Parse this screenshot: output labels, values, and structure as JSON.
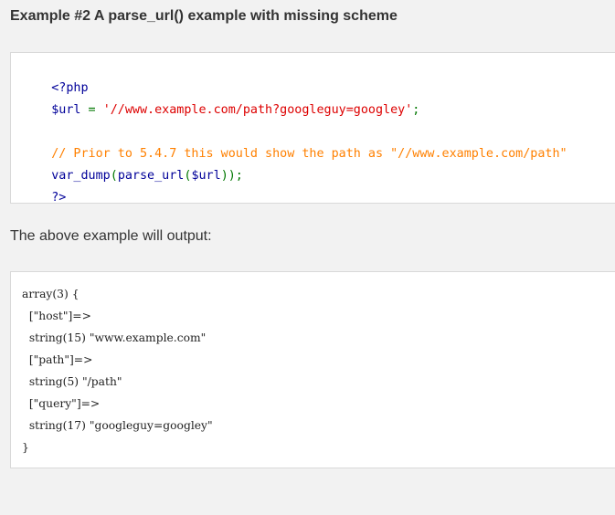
{
  "example": {
    "title": "Example #2 A parse_url() example with missing scheme"
  },
  "code": {
    "line1": "<?php",
    "line2_var": "$url",
    "line2_op": " = ",
    "line2_str": "'//www.example.com/path?googleguy=googley'",
    "line2_end": ";",
    "line4_comment": "// Prior to 5.4.7 this would show the path as \"//www.example.com/path\"",
    "line5_fn": "var_dump",
    "line5_open": "(",
    "line5_fn2": "parse_url",
    "line5_open2": "(",
    "line5_var": "$url",
    "line5_close": "));",
    "line6": "?>"
  },
  "output_label": "The above example will output:",
  "output": {
    "lines": [
      "array(3) {",
      "  [\"host\"]=>",
      "  string(15) \"www.example.com\"",
      "  [\"path\"]=>",
      "  string(5) \"/path\"",
      "  [\"query\"]=>",
      "  string(17) \"googleguy=googley\"",
      "}"
    ]
  }
}
